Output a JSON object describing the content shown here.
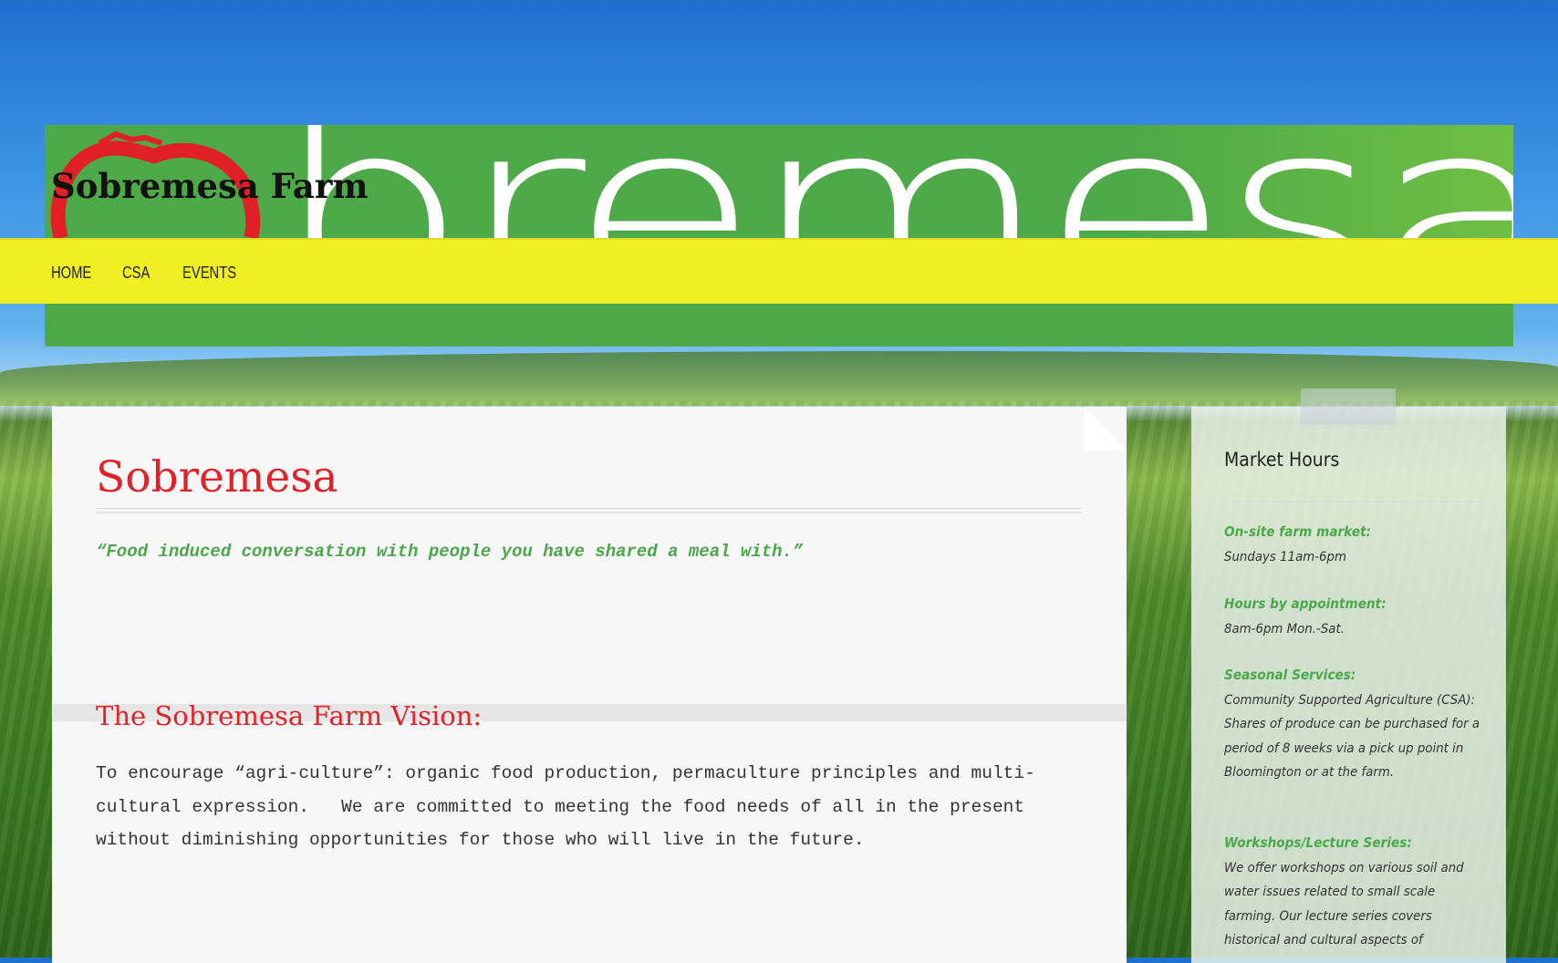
{
  "site": {
    "title": "Sobremesa Farm",
    "banner_word": "bremesa"
  },
  "nav": {
    "items": [
      {
        "label": "HOME"
      },
      {
        "label": "CSA"
      },
      {
        "label": "EVENTS"
      }
    ]
  },
  "main": {
    "title": "Sobremesa",
    "quote": "“Food induced conversation with people you have shared a meal with.”",
    "vision_title": "The Sobremesa Farm Vision:",
    "vision_text": "To encourage “agri-culture”: organic food production, permaculture principles and multi-\ncultural expression.   We are committed to meeting the food needs of all in the present\nwithout diminishing opportunities for those who will live in the future."
  },
  "sidebar": {
    "title": "Market Hours",
    "blocks": [
      {
        "label": "On-site farm market:",
        "text": "Sundays 11am-6pm"
      },
      {
        "label": "Hours by appointment:",
        "text": "8am-6pm Mon.-Sat."
      },
      {
        "label": "Seasonal Services:",
        "text": "Community Supported Agriculture (CSA): Shares of produce can be purchased for a period of 8 weeks via a pick up point in Bloomington or at the farm."
      },
      {
        "label": "Workshops/Lecture Series:",
        "text": "We offer workshops on various soil and water issues related to small scale farming. Our lecture series covers historical and cultural aspects of"
      }
    ]
  },
  "colors": {
    "accent_red": "#e0232a",
    "accent_green": "#4aa84a",
    "nav_yellow": "#f0ef24",
    "banner_green": "#4ea948"
  }
}
